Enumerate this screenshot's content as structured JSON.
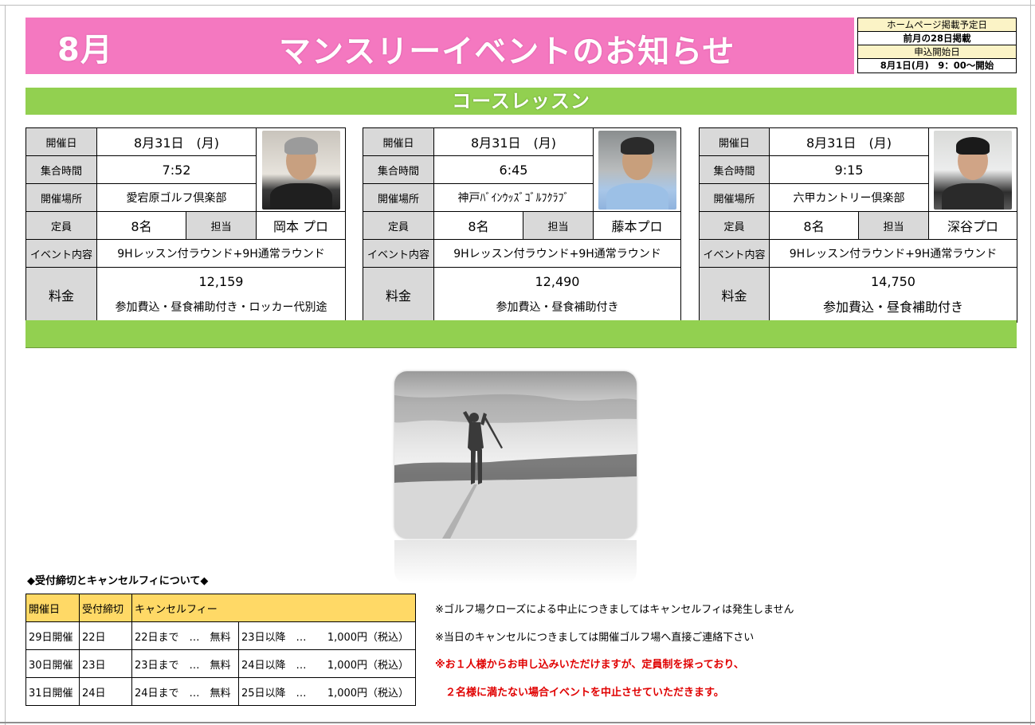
{
  "header": {
    "month": "8月",
    "title": "マンスリーイベントのお知らせ",
    "schedule": {
      "publish_label": "ホームページ掲載予定日",
      "publish_value": "前月の28日掲載",
      "apply_label": "申込開始日",
      "apply_value": "8月1日(月)　9：00～開始"
    }
  },
  "section_title": "コースレッスン",
  "labels": {
    "date": "開催日",
    "meet_time": "集合時間",
    "venue": "開催場所",
    "capacity": "定員",
    "instructor": "担当",
    "content": "イベント内容",
    "fee": "料金"
  },
  "events": [
    {
      "date": "8月31日　(月)",
      "meet_time": "7:52",
      "venue": "愛宕原ゴルフ倶楽部",
      "capacity": "8名",
      "instructor": "岡本 プロ",
      "content": "9Hレッスン付ラウンド+9H通常ラウンド",
      "fee": "12,159",
      "fee_note": "参加費込・昼食補助付き・ロッカー代別途"
    },
    {
      "date": "8月31日　(月)",
      "meet_time": "6:45",
      "venue": "神戸ﾊﾞｲﾝｳｯｽﾞｺﾞﾙﾌｸﾗﾌﾞ",
      "capacity": "8名",
      "instructor": "藤本プロ",
      "content": "9Hレッスン付ラウンド+9H通常ラウンド",
      "fee": "12,490",
      "fee_note": "参加費込・昼食補助付き"
    },
    {
      "date": "8月31日　(月)",
      "meet_time": "9:15",
      "venue": "六甲カントリー倶楽部",
      "capacity": "8名",
      "instructor": "深谷プロ",
      "content": "9Hレッスン付ラウンド+9H通常ラウンド",
      "fee": "14,750",
      "fee_note": "参加費込・昼食補助付き"
    }
  ],
  "cancel": {
    "title": "◆受付締切とキャンセルフィについて◆",
    "headers": [
      "開催日",
      "受付締切",
      "キャンセルフィー"
    ],
    "rows": [
      {
        "date": "29日開催",
        "deadline": "22日",
        "free": "22日まで　…　無料",
        "after": "23日以降　…",
        "amount": "1,000円（税込）"
      },
      {
        "date": "30日開催",
        "deadline": "23日",
        "free": "23日まで　…　無料",
        "after": "24日以降　…",
        "amount": "1,000円（税込）"
      },
      {
        "date": "31日開催",
        "deadline": "24日",
        "free": "24日まで　…　無料",
        "after": "25日以降　…",
        "amount": "1,000円（税込）"
      }
    ]
  },
  "notes": [
    "※ゴルフ場クローズによる中止につきましてはキャンセルフィは発生しません",
    "※当日のキャンセルにつきましては開催ゴルフ場へ直接ご連絡下さい",
    "※お１人様からお申し込みいただけますが、定員制を採っており、",
    "　２名様に満たない場合イベントを中止させていただきます。"
  ],
  "colors": {
    "banner": "#f478c0",
    "section_bar": "#92d050",
    "label_cell": "#d9d9d9",
    "cancel_header": "#ffd966",
    "warning_text": "#e00000"
  }
}
